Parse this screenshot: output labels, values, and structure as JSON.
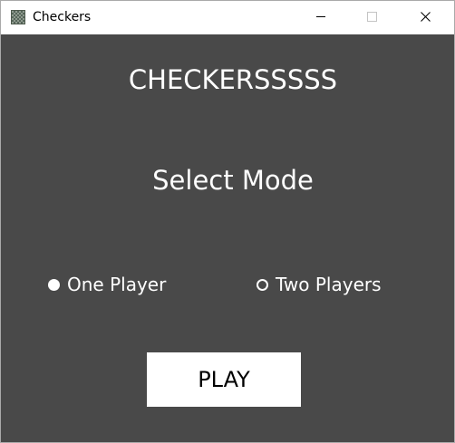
{
  "window": {
    "title": "Checkers",
    "icon": "checkerboard-icon"
  },
  "controls": {
    "minimize_icon": "minimize-icon",
    "maximize_icon": "maximize-icon",
    "close_icon": "close-icon"
  },
  "main": {
    "title": "CHECKERSSSSS",
    "subtitle": "Select Mode",
    "modes": [
      {
        "label": "One Player",
        "selected": true
      },
      {
        "label": "Two Players",
        "selected": false
      }
    ],
    "play_label": "PLAY"
  },
  "colors": {
    "background": "#494949",
    "text": "#ffffff",
    "button": "#ffffff",
    "button_text": "#000000"
  }
}
